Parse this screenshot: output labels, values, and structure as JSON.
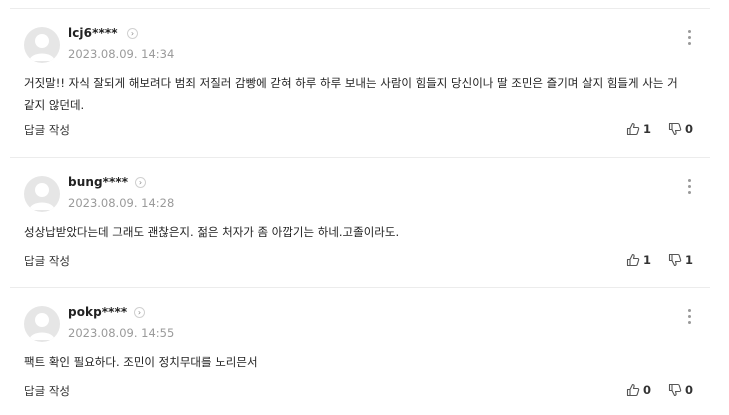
{
  "comments": [
    {
      "username": "lcj6****",
      "timestamp": "2023.08.09. 14:34",
      "body": "거짓말!! 자식 잘되게 해보려다 범죄 저질러 감빵에 갇혀 하루 하루 보내는 사람이 힘들지 당신이나 딸 조민은 즐기며 살지 힘들게 사는 거 같지 않던데.",
      "reply_label": "답글 작성",
      "likes": "1",
      "dislikes": "0"
    },
    {
      "username": "bung****",
      "timestamp": "2023.08.09. 14:28",
      "body": "성상납받았다는데 그래도 괜찮은지. 젊은 처자가 좀 아깝기는 하네.고졸이라도.",
      "reply_label": "답글 작성",
      "likes": "1",
      "dislikes": "1"
    },
    {
      "username": "pokp****",
      "timestamp": "2023.08.09. 14:55",
      "body": "팩트 확인 필요하다. 조민이 정치무대를 노리믄서",
      "reply_label": "답글 작성",
      "likes": "0",
      "dislikes": "0"
    }
  ],
  "icons": {
    "profile_arrow": "chevron-right-icon",
    "more": "more-vertical-icon",
    "like": "thumbs-up-icon",
    "dislike": "thumbs-down-icon",
    "avatar": "default-avatar-icon"
  },
  "colors": {
    "divider": "#ececec",
    "timestamp": "#9a9a9a",
    "avatar_bg": "#e6e6e6"
  }
}
